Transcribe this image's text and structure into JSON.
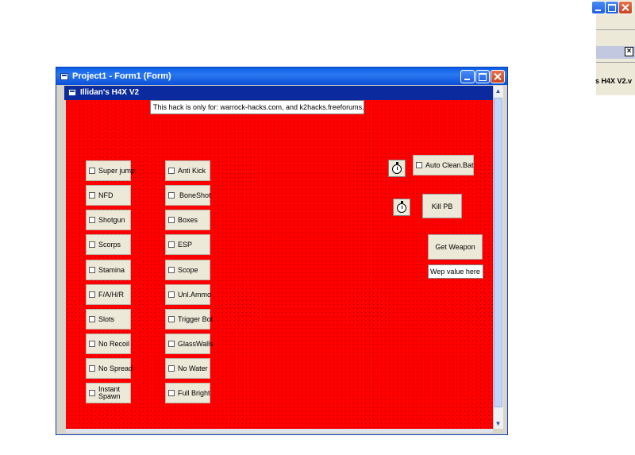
{
  "outer_window": {
    "title": "Project1 - Form1 (Form)"
  },
  "form": {
    "title": "Illidan's H4X V2"
  },
  "notice": "This hack is only for: warrock-hacks.com, and k2hacks.freeforums.com",
  "left_column": [
    "Super jump",
    "NFD",
    "Shotgun",
    "Scorps",
    "Stamina",
    "F/A/H/R",
    "Slots",
    "No Recoil",
    "No Spread",
    "Instant Spawn"
  ],
  "middle_column": [
    "Anti Kick",
    "BoneShot",
    "Boxes",
    "ESP",
    "Scope",
    "Unl.Ammo",
    "Trigger Bot",
    "GlassWalls",
    "No Water",
    "Full Bright"
  ],
  "right_panel": {
    "auto_clean": "Auto Clean.Bat",
    "kill_pb": "Kill PB",
    "get_weapon": "Get Weapon",
    "wep_value": "Wep value here"
  },
  "background_window": {
    "label": "s H4X V2.v",
    "close": "×"
  },
  "icons": [
    "timer-icon",
    "form-icon",
    "minimize-icon",
    "maximize-icon",
    "close-icon"
  ],
  "colors": {
    "form_background": "#ff0000",
    "title_bar": "#0a5ce6",
    "form_title_bar": "#0a2a9e"
  }
}
